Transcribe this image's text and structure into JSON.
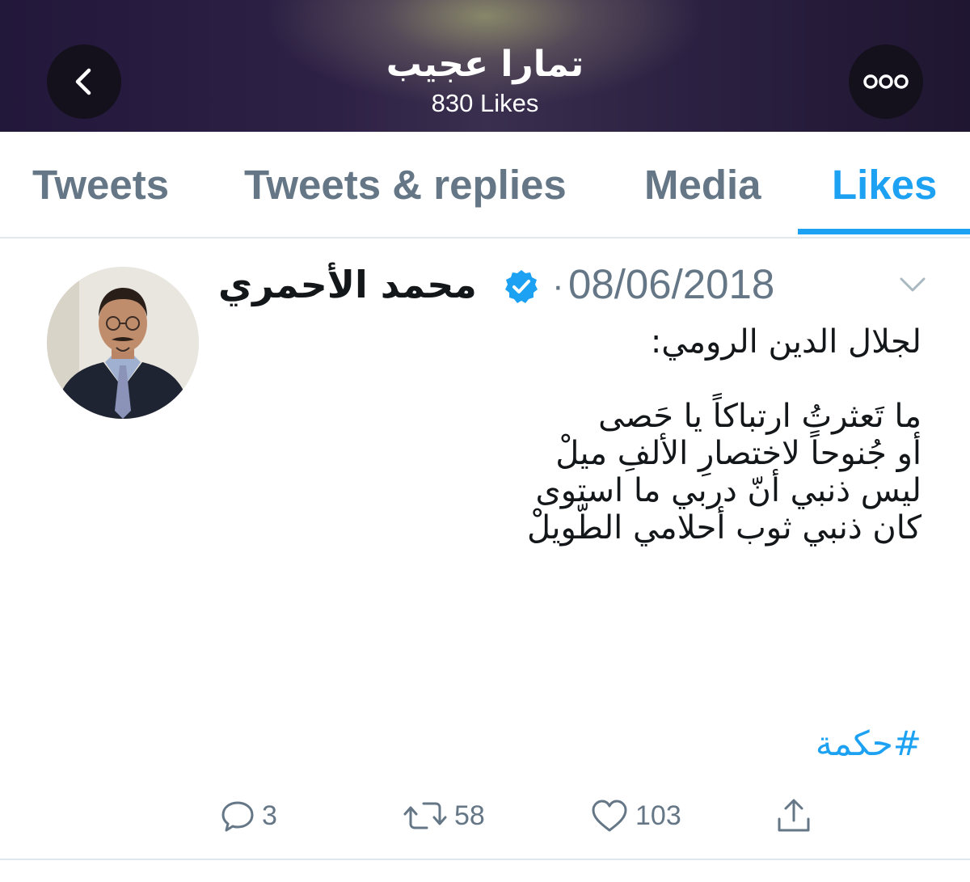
{
  "header": {
    "title": "تمارا عجيب",
    "subtitle": "830 Likes",
    "back_icon": "chevron-left-icon",
    "more_icon": "ellipsis-icon"
  },
  "tabs": [
    {
      "label": "Tweets",
      "active": false
    },
    {
      "label": "Tweets & replies",
      "active": false
    },
    {
      "label": "Media",
      "active": false
    },
    {
      "label": "Likes",
      "active": true
    }
  ],
  "tweet": {
    "author_name": "محمد الأحمري",
    "verified": true,
    "separator": "·",
    "date": "08/06/2018",
    "text_lines": [
      "لجلال الدين الرومي:",
      "",
      "ما تَعثرتُ ارتباكاً يا حَصى",
      "أو جُنوحاً لاختصارِ الألفِ ميلْ",
      "ليس ذنبي أنّ دربي ما استوى",
      "كان ذنبي ثوب أحلامي الطّويلْ"
    ],
    "hashtag": "#حكمة",
    "actions": {
      "reply_count": "3",
      "retweet_count": "58",
      "like_count": "103"
    }
  },
  "colors": {
    "accent": "#1da1f2",
    "muted": "#657786",
    "text": "#14171a",
    "divider": "#e1e8ed"
  }
}
